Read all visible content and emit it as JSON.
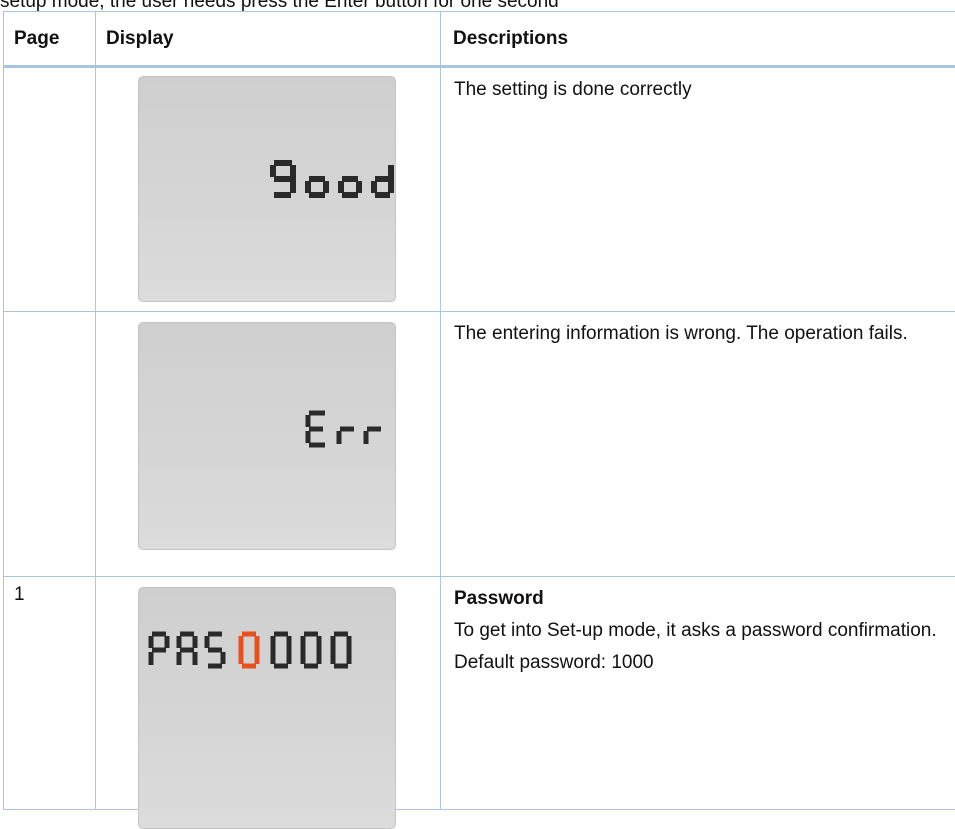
{
  "intro_text": "setup mode, the user needs press the Enter button for one second",
  "table": {
    "headers": {
      "page": "Page",
      "display": "Display",
      "descriptions": "Descriptions"
    },
    "rows": [
      {
        "page": "",
        "lcd_text": "Good",
        "desc_title": "",
        "desc_lines": [
          "The setting is done correctly"
        ]
      },
      {
        "page": "",
        "lcd_text": "Err",
        "desc_title": "",
        "desc_lines": [
          "The entering information is wrong. The operation fails."
        ]
      },
      {
        "page": "1",
        "lcd_text": "PAS0000",
        "lcd_highlight_digit_index": 3,
        "desc_title": "Password",
        "desc_lines": [
          "To get into Set-up mode, it asks a password confirmation.",
          "Default password: 1000"
        ]
      }
    ]
  },
  "colors": {
    "border": "#a9c6e1",
    "lcd_bg": "#d3d3d3",
    "segment": "#2a2a2a",
    "highlight_digit": "#e8501e"
  }
}
